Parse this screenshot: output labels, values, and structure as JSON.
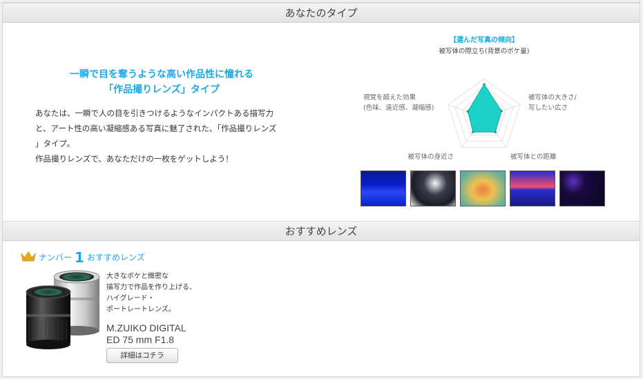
{
  "sections": {
    "type_title": "あなたのタイプ",
    "recommend_title": "おすすめレンズ"
  },
  "type_result": {
    "headline_line1": "一瞬で目を奪うような高い作品性に憧れる",
    "headline_line2": "「作品撮りレンズ」タイプ",
    "description": [
      "あなたは、一瞬で人の目を引きつけるようなインパクトある描写力",
      "と、アート性の高い凝縮感ある写真に魅了された、「作品撮りレンズ",
      "」タイプ。",
      "作品撮りレンズで、あなただけの一枚をゲットしよう！"
    ]
  },
  "radar": {
    "title": "【選んだ写真の傾向】",
    "axes": [
      {
        "label": "被写体の際立ち(背景のボケ量)",
        "value": 0.85
      },
      {
        "label": "被写体の大きさ/写したい広さ",
        "label_lines": [
          "被写体の大きさ/",
          "写したい広さ"
        ],
        "value": 0.48
      },
      {
        "label": "被写体との距離",
        "value": 0.5
      },
      {
        "label": "被写体の身近さ",
        "value": 0.5
      },
      {
        "label": "視覚を超えた効果(色味、遠近感、凝縮感)",
        "label_lines": [
          "視覚を超えた効果",
          "(色味、遠近感、凝縮感)"
        ],
        "value": 0.45
      }
    ],
    "levels": 5,
    "fill_color": "#1dd0c8",
    "stroke_color": "#0aa89f",
    "grid_color": "#e2e2e2",
    "title_color": "#1da8e8"
  },
  "thumbnails": [
    {
      "name": "photo-blue-lake",
      "colors": [
        "#0a1fd0",
        "#2a48f0",
        "#081890"
      ]
    },
    {
      "name": "photo-flowers-mono",
      "colors": [
        "#f5f5f5",
        "#3a3a4a",
        "#1c1c28"
      ]
    },
    {
      "name": "photo-tulip",
      "colors": [
        "#e88040",
        "#f0c050",
        "#60b0a0"
      ]
    },
    {
      "name": "photo-sunset-sea",
      "colors": [
        "#2a2ad0",
        "#f05070",
        "#1a1a80"
      ]
    },
    {
      "name": "photo-purple-bokeh",
      "colors": [
        "#1a0a40",
        "#6030c0",
        "#0a0520"
      ]
    }
  ],
  "recommendation": {
    "rank_label_pre": "ナンバー",
    "rank_number": "1",
    "rank_label_post": "おすすめレンズ",
    "crown_color": "#e8a818",
    "description": [
      "大きなボケと緻密な",
      "描写力で作品を作り上げる、",
      "ハイグレード・",
      "ポートレートレンズ。"
    ],
    "lens_name_line1": "M.ZUIKO DIGITAL",
    "lens_name_line2": "ED 75 mm F1.8",
    "detail_button": "詳細はコチラ"
  }
}
